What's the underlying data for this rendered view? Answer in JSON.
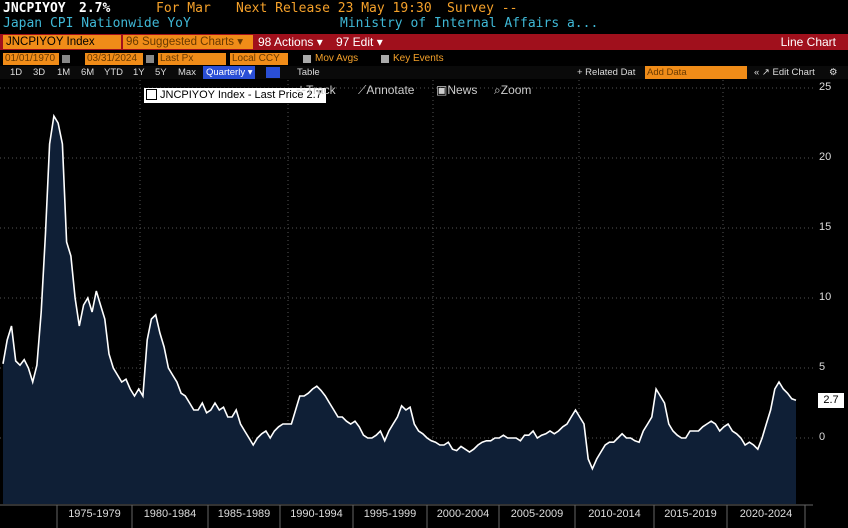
{
  "header": {
    "ticker": "JNCPIYOY",
    "last_value": "2.7%",
    "period": "For Mar",
    "next_release": "Next Release 23 May 19:30",
    "survey": "Survey --",
    "description": "Japan CPI Nationwide YoY",
    "source": "Ministry of Internal Affairs a..."
  },
  "toolbar": {
    "security": "JNCPIYOY Index",
    "suggested": "96 Suggested Charts ▾",
    "actions": "98 Actions ▾",
    "edit": "97 Edit ▾",
    "chart_type": "Line Chart"
  },
  "controls": {
    "start_date": "01/01/1970",
    "end_date": "03/31/2024",
    "field": "Last Px",
    "currency": "Local CCY",
    "mov_avgs": "Mov Avgs",
    "key_events": "Key Events"
  },
  "tabs": {
    "ranges": [
      "1D",
      "3D",
      "1M",
      "6M",
      "YTD",
      "1Y",
      "5Y",
      "Max"
    ],
    "frequency": "Quarterly ▾",
    "table": "Table",
    "related": "+ Related Dat",
    "add_data": "Add Data",
    "edit_chart": "« ↗ Edit Chart",
    "settings_icon": "gear-icon"
  },
  "legend": {
    "label": "JNCPIYOY Index - Last Price 2.7"
  },
  "chart_tools": {
    "track": "Track",
    "annotate": "Annotate",
    "news": "News",
    "zoom": "Zoom"
  },
  "chart_data": {
    "type": "area",
    "title": "",
    "xlabel": "",
    "ylabel": "",
    "x_start": 1970,
    "x_end": 2024.25,
    "ylim": [
      -4.6,
      25
    ],
    "y_ticks": [
      "25",
      "20",
      "15",
      "10",
      "5",
      "0"
    ],
    "x_labels": [
      "1975-1979",
      "1980-1984",
      "1985-1989",
      "1990-1994",
      "1995-1999",
      "2000-2004",
      "2005-2009",
      "2010-2014",
      "2015-2019",
      "2020-2024"
    ],
    "last_label": "2.7",
    "grid": true,
    "fill_color": "#0f1f36",
    "line_color": "#ffffff",
    "series": [
      {
        "name": "JNCPIYOY Index",
        "values": [
          5.3,
          7.0,
          8.0,
          5.5,
          5.2,
          5.6,
          5.0,
          4.0,
          5.2,
          9.0,
          14.5,
          21.0,
          23.0,
          22.5,
          21.0,
          14.0,
          13.0,
          10.0,
          8.0,
          9.5,
          10.0,
          9.0,
          10.5,
          9.5,
          8.5,
          6.0,
          5.0,
          4.5,
          4.0,
          4.2,
          3.5,
          3.0,
          3.5,
          3.0,
          7.0,
          8.5,
          8.8,
          7.5,
          6.5,
          5.0,
          4.5,
          4.0,
          3.2,
          3.0,
          2.5,
          2.0,
          2.0,
          2.5,
          1.8,
          2.0,
          2.5,
          2.0,
          2.2,
          1.5,
          1.5,
          2.0,
          1.0,
          0.5,
          0.0,
          -0.5,
          0.0,
          0.3,
          0.5,
          0.0,
          0.5,
          0.8,
          1.0,
          1.0,
          1.0,
          2.0,
          3.0,
          3.0,
          3.2,
          3.5,
          3.7,
          3.4,
          3.0,
          2.5,
          2.0,
          1.5,
          1.5,
          1.2,
          1.0,
          1.2,
          0.8,
          0.2,
          0.0,
          0.0,
          0.2,
          0.5,
          -0.2,
          0.5,
          1.0,
          1.5,
          2.3,
          2.0,
          2.2,
          1.0,
          0.5,
          0.3,
          0.0,
          -0.2,
          -0.3,
          -0.5,
          -0.5,
          -0.3,
          -0.8,
          -0.9,
          -0.6,
          -0.8,
          -1.0,
          -0.8,
          -0.5,
          -0.3,
          -0.2,
          -0.2,
          0.0,
          0.0,
          0.2,
          0.0,
          0.0,
          0.0,
          -0.2,
          0.2,
          0.2,
          0.5,
          0.0,
          0.2,
          0.3,
          0.5,
          0.3,
          0.5,
          0.8,
          1.0,
          1.5,
          2.0,
          1.5,
          1.0,
          -1.5,
          -2.2,
          -1.5,
          -1.0,
          -0.5,
          -0.3,
          -0.3,
          0.0,
          0.3,
          0.0,
          0.0,
          -0.2,
          -0.3,
          0.5,
          1.0,
          1.5,
          3.5,
          3.0,
          2.5,
          1.0,
          0.5,
          0.2,
          0.0,
          0.0,
          0.5,
          0.5,
          0.5,
          0.8,
          1.0,
          1.2,
          1.0,
          0.5,
          0.8,
          1.0,
          0.5,
          0.3,
          0.0,
          -0.5,
          -0.3,
          -0.5,
          -0.8,
          0.0,
          1.0,
          2.0,
          3.5,
          4.0,
          3.5,
          3.2,
          2.8,
          2.7
        ]
      }
    ]
  }
}
